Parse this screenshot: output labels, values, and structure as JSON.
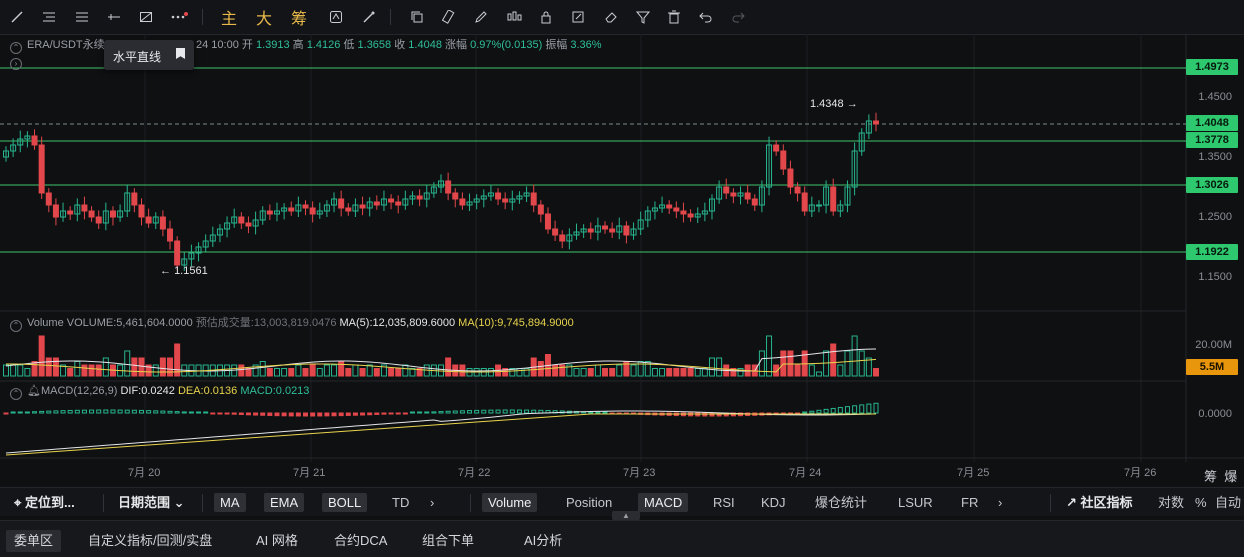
{
  "toolbar": {
    "drawing_tools": [
      "line-tool",
      "horizontal-lines-tool",
      "parallel-lines-tool",
      "ray-tool",
      "shape-tool",
      "more-tools"
    ],
    "main_label": "主",
    "big_label": "大",
    "chip_label": "筹"
  },
  "header": {
    "symbol": "ERA/USDT永续",
    "time": "24 10:00",
    "open_label": "开",
    "open": "1.3913",
    "high_label": "高",
    "high": "1.4126",
    "low_label": "低",
    "low": "1.3658",
    "close_label": "收",
    "close": "1.4048",
    "change_label": "涨幅",
    "change": "0.97%(0.0135)",
    "amp_label": "振幅",
    "amp": "3.36%"
  },
  "tooltip": {
    "text": "水平直线"
  },
  "price_levels": {
    "l1": "1.4973",
    "l2": "1.4048",
    "l3": "1.3778",
    "l4": "1.3026",
    "l5": "1.1922"
  },
  "price_axis": [
    "1.4500",
    "1.3500",
    "1.2500",
    "1.1500"
  ],
  "annotations": {
    "high": "1.4348",
    "low": "1.1561"
  },
  "volume": {
    "label": "Volume",
    "volume_text": "VOLUME:5,461,604.0000",
    "est_text": "预估成交量:13,003,819.0476",
    "ma5_text": "MA(5):12,035,809.6000",
    "ma10_text": "MA(10):9,745,894.9000",
    "axis_top": "20.00M",
    "current_label": "5.5M"
  },
  "macd": {
    "title": "MACD(12,26,9)",
    "dif": "DIF:0.0242",
    "dea": "DEA:0.0136",
    "macd": "MACD:0.0213",
    "axis": "0.0000"
  },
  "x_axis": [
    "7月 20",
    "7月 21",
    "7月 22",
    "7月 23",
    "7月 24",
    "7月 25",
    "7月 26"
  ],
  "corner": {
    "chip": "筹",
    "burst": "爆"
  },
  "bottom_bar": {
    "locate": "定位到...",
    "date_range": "日期范围",
    "ma": "MA",
    "ema": "EMA",
    "boll": "BOLL",
    "td": "TD",
    "vol": "Volume",
    "position": "Position",
    "macd": "MACD",
    "rsi": "RSI",
    "kdj": "KDJ",
    "liq": "爆仓统计",
    "lsur": "LSUR",
    "fr": "FR",
    "community": "社区指标",
    "log": "对数",
    "pct": "%",
    "auto": "自动"
  },
  "bottom_tabs": [
    "委单区",
    "自定义指标/回测/实盘",
    "AI 网格",
    "合约DCA",
    "组合下单",
    "AI分析"
  ],
  "colors": {
    "up": "#27b58e",
    "down": "#e2474b",
    "level": "#3fc46c",
    "ma5": "#e4e6ea",
    "ma10": "#e8d44d"
  }
}
